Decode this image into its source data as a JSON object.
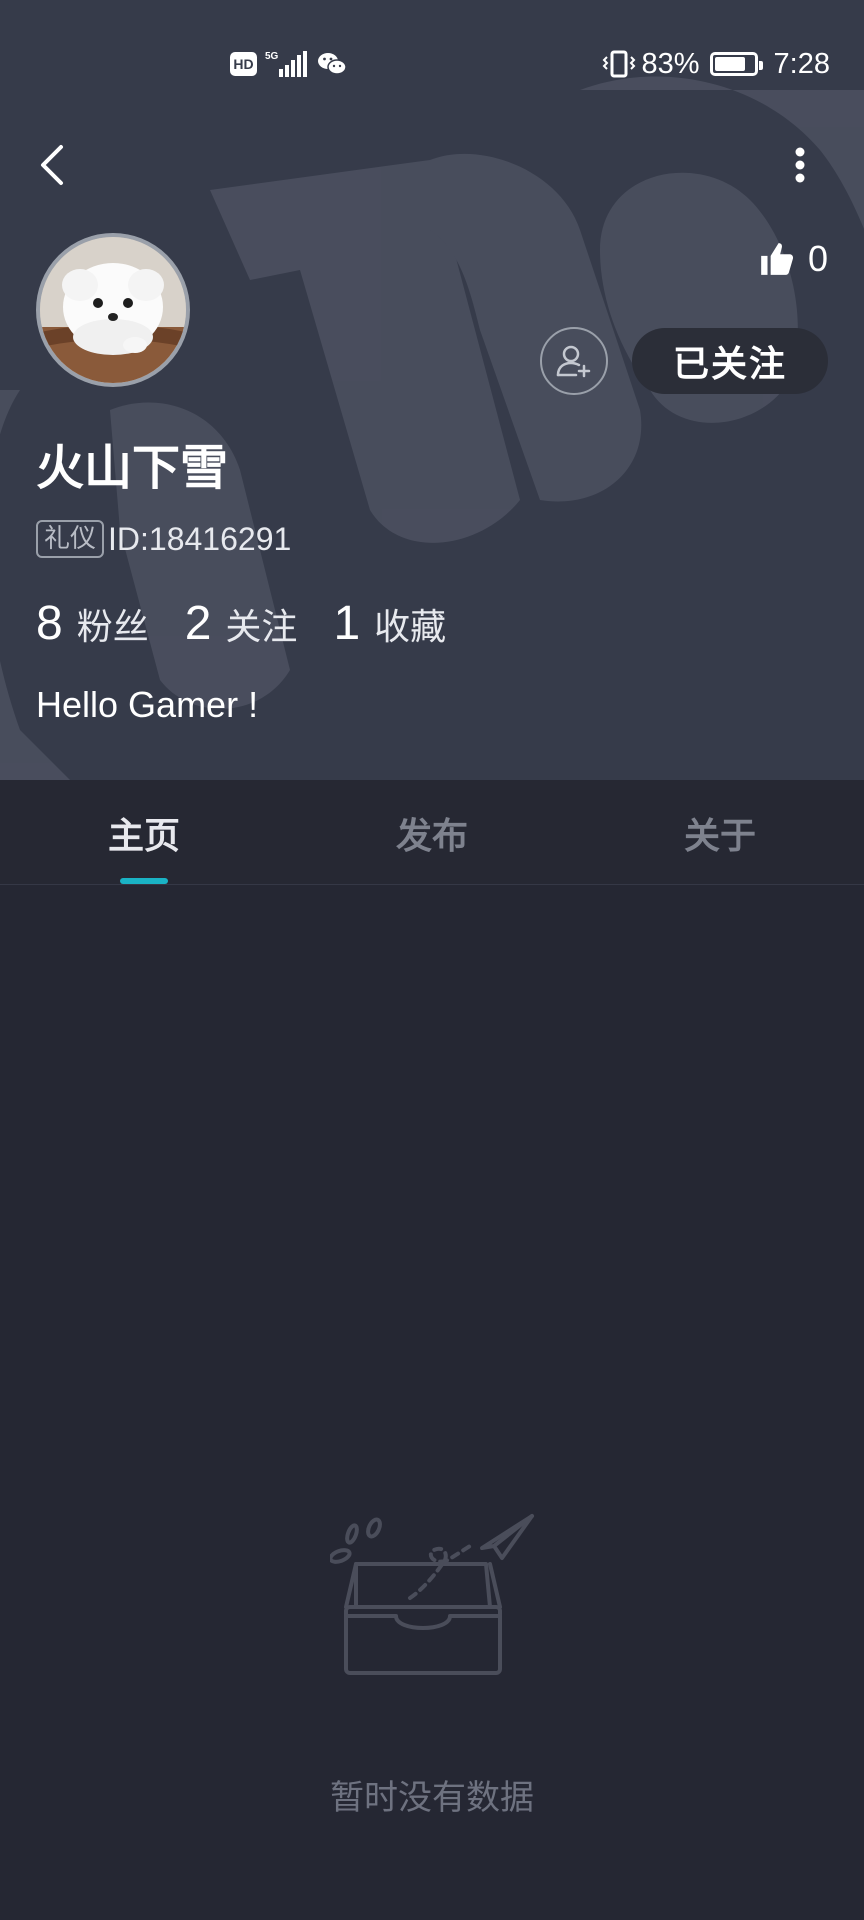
{
  "status_bar": {
    "hd_badge": "HD",
    "network": "5G",
    "battery_percent": "83%",
    "battery_level": 0.83,
    "time": "7:28"
  },
  "profile": {
    "likes_count": "0",
    "follow_label": "已关注",
    "name": "火山下雪",
    "tag": "礼仪",
    "id_text": "ID:18416291",
    "stats": [
      {
        "value": "8",
        "label": "粉丝"
      },
      {
        "value": "2",
        "label": "关注"
      },
      {
        "value": "1",
        "label": "收藏"
      }
    ],
    "bio": "Hello Gamer !"
  },
  "tabs": [
    {
      "label": "主页",
      "active": true
    },
    {
      "label": "发布",
      "active": false
    },
    {
      "label": "关于",
      "active": false
    }
  ],
  "empty_state": {
    "message": "暂时没有数据"
  },
  "colors": {
    "header_bg": "#363b4a",
    "page_bg": "#252733",
    "accent": "#1ab3c5"
  },
  "icons": [
    "back-arrow-icon",
    "more-vertical-icon",
    "thumbs-up-icon",
    "add-friend-icon",
    "empty-inbox-icon",
    "paper-plane-icon"
  ]
}
